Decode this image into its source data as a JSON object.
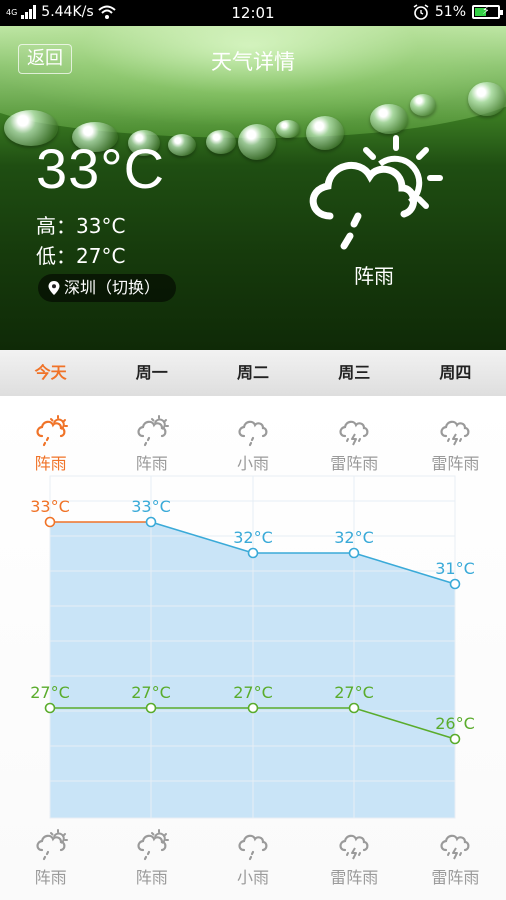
{
  "status_bar": {
    "network": "4G",
    "speed": "5.44K/s",
    "time": "12:01",
    "battery": "51%",
    "battery_level": 0.51
  },
  "header": {
    "back_label": "返回",
    "title": "天气详情"
  },
  "current": {
    "temp": "33°C",
    "high": "高：33°C",
    "low": "低：27°C",
    "location": "深圳（切换）",
    "condition": "阵雨",
    "icon": "partly-cloudy-rain-icon"
  },
  "tabs": [
    {
      "label": "今天",
      "active": true
    },
    {
      "label": "周一",
      "active": false
    },
    {
      "label": "周二",
      "active": false
    },
    {
      "label": "周三",
      "active": false
    },
    {
      "label": "周四",
      "active": false
    }
  ],
  "forecast_top": [
    {
      "condition": "阵雨",
      "icon": "sun-cloud-rain-icon"
    },
    {
      "condition": "阵雨",
      "icon": "sun-cloud-rain-icon"
    },
    {
      "condition": "小雨",
      "icon": "cloud-rain-icon"
    },
    {
      "condition": "雷阵雨",
      "icon": "cloud-thunder-rain-icon"
    },
    {
      "condition": "雷阵雨",
      "icon": "cloud-thunder-rain-icon"
    }
  ],
  "forecast_bottom": [
    {
      "condition": "阵雨",
      "icon": "sun-cloud-rain-icon"
    },
    {
      "condition": "阵雨",
      "icon": "sun-cloud-rain-icon"
    },
    {
      "condition": "小雨",
      "icon": "cloud-rain-icon"
    },
    {
      "condition": "雷阵雨",
      "icon": "cloud-thunder-rain-icon"
    },
    {
      "condition": "雷阵雨",
      "icon": "cloud-thunder-rain-icon"
    }
  ],
  "colors": {
    "accent": "#f07328",
    "high_line": "#3aaad8",
    "low_line": "#5aac2c",
    "fill": "#c6e3f7"
  },
  "chart_data": {
    "type": "line",
    "categories": [
      "今天",
      "周一",
      "周二",
      "周三",
      "周四"
    ],
    "series": [
      {
        "values": [
          33,
          33,
          32,
          32,
          31
        ],
        "labels": [
          "33°C",
          "33°C",
          "32°C",
          "32°C",
          "31°C"
        ]
      },
      {
        "values": [
          27,
          27,
          27,
          27,
          26
        ],
        "labels": [
          "27°C",
          "27°C",
          "27°C",
          "27°C",
          "26°C"
        ]
      }
    ],
    "ylim": [
      24,
      34
    ],
    "grid": true
  }
}
